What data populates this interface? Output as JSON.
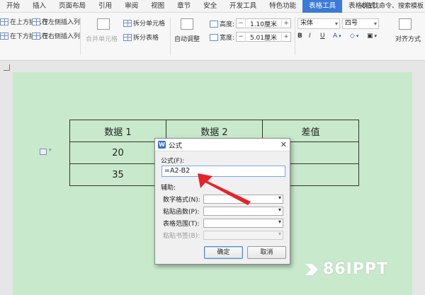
{
  "ribbon": {
    "tabs": [
      {
        "label": "开始"
      },
      {
        "label": "插入"
      },
      {
        "label": "页面布局"
      },
      {
        "label": "引用"
      },
      {
        "label": "审阅"
      },
      {
        "label": "视图"
      },
      {
        "label": "章节"
      },
      {
        "label": "安全"
      },
      {
        "label": "开发工具"
      },
      {
        "label": "特色功能"
      },
      {
        "label": "表格工具"
      },
      {
        "label": "表格样式"
      }
    ],
    "active_tab": "表格工具",
    "search_label": "Q查找命令、搜索模板",
    "toolbar": {
      "insert_above": "在上方插入行",
      "insert_below": "在下方插入行",
      "insert_left": "在左侧插入列",
      "insert_right": "在右侧插入列",
      "merge_cells": "合并单元格",
      "split_cells": "拆分单元格",
      "split_table": "拆分表格",
      "auto_fit": "自动调整",
      "height_label": "高度:",
      "height_value": "1.10厘米",
      "width_label": "宽度:",
      "width_value": "5.01厘米",
      "font_name": "宋体",
      "font_size": "四号",
      "align": "对齐方式"
    }
  },
  "table": {
    "rows": [
      [
        "数据 1",
        "数据 2",
        "差值"
      ],
      [
        "20",
        "",
        ""
      ],
      [
        "35",
        "",
        ""
      ]
    ]
  },
  "dialog": {
    "title": "公式",
    "formula_label": "公式(F):",
    "formula_value": "=A2-B2",
    "aux_label": "辅助:",
    "number_format_label": "数字格式(N):",
    "paste_function_label": "粘贴函数(P):",
    "table_range_label": "表格范围(T):",
    "paste_bookmark_label": "粘贴书签(B):",
    "ok_label": "确定",
    "cancel_label": "取消"
  },
  "watermark": {
    "text": "86IPPT"
  },
  "colors": {
    "page_bg": "#c8e9cb",
    "active_tab": "#3b7ad6",
    "arrow": "#e8212b"
  }
}
